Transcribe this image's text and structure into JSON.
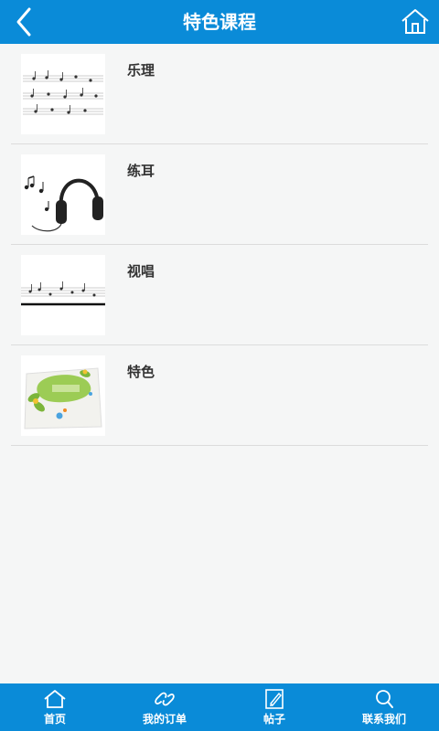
{
  "header": {
    "title": "特色课程"
  },
  "courses": [
    {
      "label": "乐理",
      "thumb_icon": "sheet-music-thumbnail"
    },
    {
      "label": "练耳",
      "thumb_icon": "headphones-thumbnail"
    },
    {
      "label": "视唱",
      "thumb_icon": "score-line-thumbnail"
    },
    {
      "label": "特色",
      "thumb_icon": "flower-card-thumbnail"
    }
  ],
  "tabbar": {
    "items": [
      {
        "label": "首页",
        "icon": "home-icon"
      },
      {
        "label": "我的订单",
        "icon": "link-icon"
      },
      {
        "label": "帖子",
        "icon": "edit-icon"
      },
      {
        "label": "联系我们",
        "icon": "search-icon"
      }
    ]
  },
  "colors": {
    "header_bg": "#0a8bd8",
    "page_bg": "#f5f6f6",
    "text": "#333333",
    "divider": "#dcdcdc"
  }
}
